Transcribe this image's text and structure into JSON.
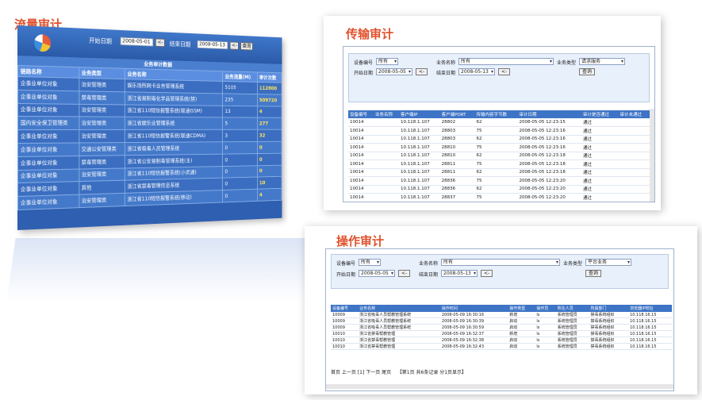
{
  "traffic": {
    "title": "流量审计",
    "start_label": "开始日期",
    "start_value": "2008-05-01",
    "end_label": "结束日期",
    "end_value": "2008-05-13",
    "picker_btn": "<-",
    "query_btn": "查询",
    "subtitle": "业务审计数据",
    "columns": [
      "链路名称",
      "业务类型",
      "业务名称",
      "业务流量(M)",
      "审计次数"
    ],
    "rows": [
      [
        "企事业单位对象",
        "治安管理类",
        "娱乐场所网卡业务管理系统",
        "5105",
        "112800"
      ],
      [
        "企事业单位对象",
        "禁毒管理类",
        "浙江省易制毒化学品管理系统(禁)",
        "235",
        "509720"
      ],
      [
        "企事业单位对象",
        "治安管理类",
        "浙江省110短信报警系统(联通GSM)",
        "13",
        "4"
      ],
      [
        "国内安全保卫管理类",
        "治安管理类",
        "浙江省娱乐业管理系统",
        "5",
        "277"
      ],
      [
        "企事业单位对象",
        "治安管理类",
        "浙江省110短信报警系统(联通CDMA)",
        "3",
        "32"
      ],
      [
        "企事业单位对象",
        "交通公安管理类",
        "浙江省吸毒人员管理系统",
        "0",
        "0"
      ],
      [
        "企事业单位对象",
        "禁毒管理类",
        "浙江省公安易制毒管理系统(主)",
        "0",
        "0"
      ],
      [
        "企事业单位对象",
        "治安管理类",
        "浙江省110短信报警系统(小灵通)",
        "0",
        "0"
      ],
      [
        "企事业单位对象",
        "其他",
        "浙江省禁毒管理信息系统",
        "0",
        "10"
      ],
      [
        "企事业单位对象",
        "治安管理类",
        "浙江省110短信报警系统(移动)",
        "0",
        "4"
      ]
    ]
  },
  "transfer": {
    "title": "传输审计",
    "device_label": "设备编号",
    "device_value": "所有",
    "service_label": "业务名称",
    "service_value": "所有",
    "type_label": "业务类型",
    "type_value": "请求服务",
    "start_label": "开始日期",
    "start_value": "2008-05-05",
    "end_label": "结束日期",
    "end_value": "2008-05-13",
    "picker_btn": "<-",
    "query_btn": "查询",
    "columns": [
      "设备编号",
      "业务名称",
      "客户端IP",
      "客户端PORT",
      "传输内容字节数",
      "审计日期",
      "审计是否通过",
      "审计未通过"
    ],
    "rows": [
      [
        "10014",
        "",
        "10.118.1.107",
        "28802",
        "62",
        "2008-05-05 12:23:15",
        "通过",
        ""
      ],
      [
        "10014",
        "",
        "10.118.1.107",
        "28803",
        "75",
        "2008-05-05 12:23:16",
        "通过",
        ""
      ],
      [
        "10014",
        "",
        "10.118.1.107",
        "28803",
        "62",
        "2008-05-05 12:23:16",
        "通过",
        ""
      ],
      [
        "10014",
        "",
        "10.118.1.107",
        "28810",
        "75",
        "2008-05-05 12:23:16",
        "通过",
        ""
      ],
      [
        "10014",
        "",
        "10.118.1.107",
        "28810",
        "62",
        "2008-05-05 12:23:18",
        "通过",
        ""
      ],
      [
        "10014",
        "",
        "10.118.1.107",
        "28811",
        "75",
        "2008-05-05 12:23:18",
        "通过",
        ""
      ],
      [
        "10014",
        "",
        "10.118.1.107",
        "28811",
        "62",
        "2008-05-05 12:23:18",
        "通过",
        ""
      ],
      [
        "10014",
        "",
        "10.118.1.107",
        "28836",
        "75",
        "2008-05-05 12:23:20",
        "通过",
        ""
      ],
      [
        "10014",
        "",
        "10.118.1.107",
        "28836",
        "62",
        "2008-05-05 12:23:20",
        "通过",
        ""
      ],
      [
        "10014",
        "",
        "10.118.1.107",
        "28837",
        "75",
        "2008-05-05 12:23:20",
        "通过",
        ""
      ]
    ]
  },
  "operation": {
    "title": "操作审计",
    "device_label": "设备编号",
    "device_value": "所有",
    "service_label": "业务名称",
    "service_value": "所有",
    "type_label": "业务类型",
    "type_value": "平台业务",
    "start_label": "开始日期",
    "start_value": "2008-05-05",
    "end_label": "结束日期",
    "end_value": "2008-05-13",
    "picker_btn": "<-",
    "query_btn": "查询",
    "columns": [
      "设备编号",
      "业务名称",
      "操作时间",
      "操作类型",
      "操作员",
      "所在人员",
      "所属部门",
      "浏览器IP地址"
    ],
    "rows": [
      [
        "10009",
        "浙江省吸毒人员帮教管理系统",
        "2008-05-09 16:30:16",
        "新增",
        "ls",
        "系统管理员",
        "禁毒系统组织",
        "10.118.16.15"
      ],
      [
        "10009",
        "浙江省吸毒人员帮教管理系统",
        "2008-05-09 16:30:39",
        "启动",
        "ls",
        "系统管理员",
        "禁毒系统组织",
        "10.118.16.15"
      ],
      [
        "10009",
        "浙江省吸毒人员帮教管理系统",
        "2008-05-09 16:30:59",
        "启动",
        "ls",
        "系统管理员",
        "禁毒系统组织",
        "10.118.16.15"
      ],
      [
        "10010",
        "浙江省禁毒帮教管理",
        "2008-05-09 16:32:37",
        "新增",
        "ls",
        "系统管理员",
        "禁毒系统组织",
        "10.118.16.15"
      ],
      [
        "10010",
        "浙江省禁毒帮教管理",
        "2008-05-09 16:32:38",
        "启动",
        "ls",
        "系统管理员",
        "禁毒系统组织",
        "10.118.16.15"
      ],
      [
        "10010",
        "浙江省禁毒帮教管理",
        "2008-05-09 16:32:43",
        "启动",
        "ls",
        "系统管理员",
        "禁毒系统组织",
        "10.118.16.15"
      ]
    ],
    "pager": "首页 上一页 [1] 下一页 尾页",
    "pager_info": "【第1页 共6条记录 分1页显示】"
  }
}
